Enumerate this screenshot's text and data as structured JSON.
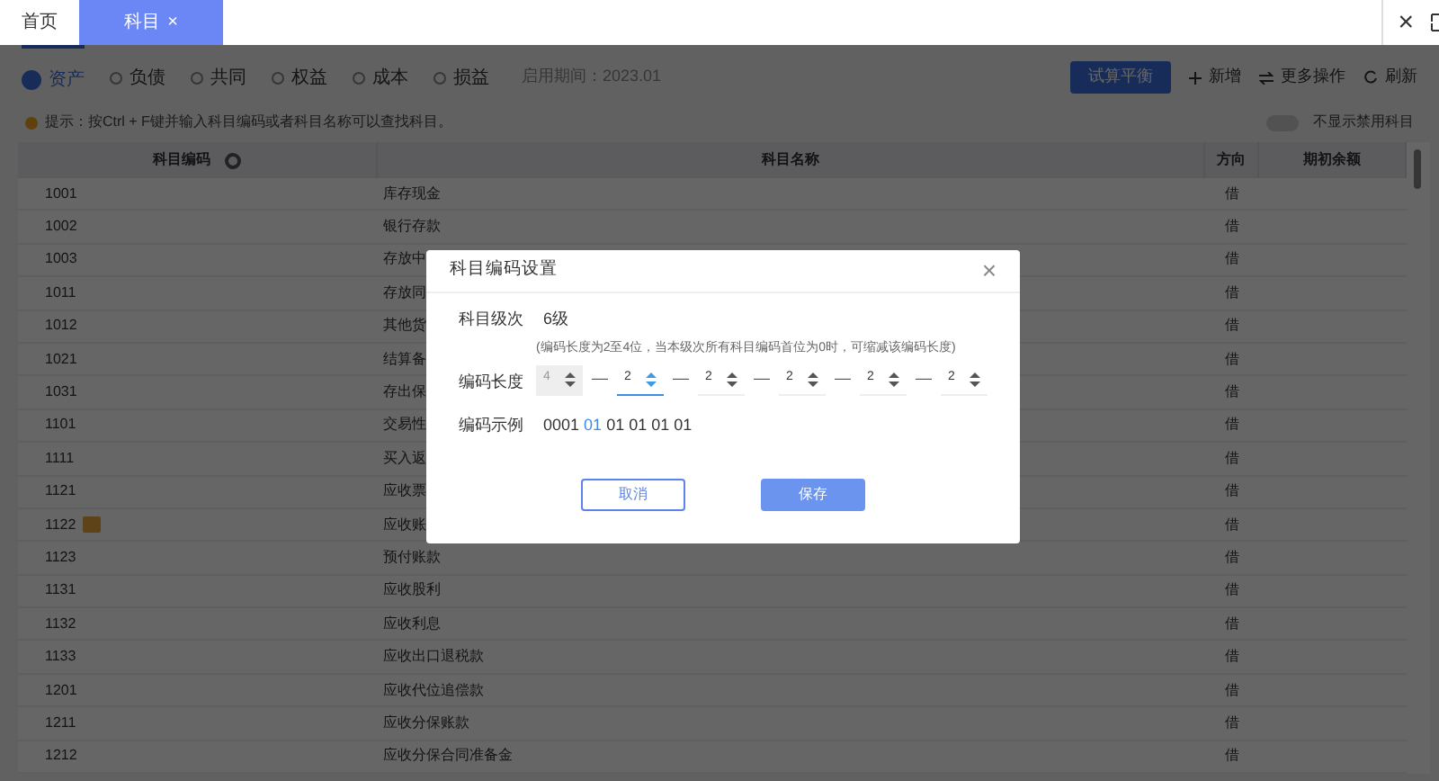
{
  "top_tabs": [
    {
      "label": "首页",
      "selected": false
    },
    {
      "label": "科目",
      "selected": true,
      "close": "×"
    }
  ],
  "window_controls": {
    "close": "×"
  },
  "categories": [
    {
      "label": "资产",
      "selected": true
    },
    {
      "label": "负债",
      "selected": false
    },
    {
      "label": "共同",
      "selected": false
    },
    {
      "label": "权益",
      "selected": false
    },
    {
      "label": "成本",
      "selected": false
    },
    {
      "label": "损益",
      "selected": false
    }
  ],
  "period": "启用期间：2023.01",
  "actions": {
    "primary": "试算平衡",
    "add": "新增",
    "more": "更多操作",
    "refresh": "刷新"
  },
  "hint": "提示：按Ctrl + F键并输入科目编码或者科目名称可以查找科目。",
  "hide_disabled": {
    "label": "不显示禁用科目",
    "on": false
  },
  "table": {
    "columns": [
      "科目编码",
      "科目名称",
      "方向",
      "期初余额"
    ],
    "rows": [
      {
        "code": "1001",
        "name": "库存现金",
        "direction": "借",
        "tag": false
      },
      {
        "code": "1002",
        "name": "银行存款",
        "direction": "借",
        "tag": false
      },
      {
        "code": "1003",
        "name": "存放中",
        "direction": "借",
        "tag": false
      },
      {
        "code": "1011",
        "name": "存放同",
        "direction": "借",
        "tag": false
      },
      {
        "code": "1012",
        "name": "其他货",
        "direction": "借",
        "tag": false
      },
      {
        "code": "1021",
        "name": "结算备",
        "direction": "借",
        "tag": false
      },
      {
        "code": "1031",
        "name": "存出保",
        "direction": "借",
        "tag": false
      },
      {
        "code": "1101",
        "name": "交易性",
        "direction": "借",
        "tag": false
      },
      {
        "code": "1111",
        "name": "买入返",
        "direction": "借",
        "tag": false
      },
      {
        "code": "1121",
        "name": "应收票",
        "direction": "借",
        "tag": false
      },
      {
        "code": "1122",
        "name": "应收账",
        "direction": "借",
        "tag": true
      },
      {
        "code": "1123",
        "name": "预付账款",
        "direction": "借",
        "tag": false
      },
      {
        "code": "1131",
        "name": "应收股利",
        "direction": "借",
        "tag": false
      },
      {
        "code": "1132",
        "name": "应收利息",
        "direction": "借",
        "tag": false
      },
      {
        "code": "1133",
        "name": "应收出口退税款",
        "direction": "借",
        "tag": false
      },
      {
        "code": "1201",
        "name": "应收代位追偿款",
        "direction": "借",
        "tag": false
      },
      {
        "code": "1211",
        "name": "应收分保账款",
        "direction": "借",
        "tag": false
      },
      {
        "code": "1212",
        "name": "应收分保合同准备金",
        "direction": "借",
        "tag": false
      }
    ]
  },
  "dialog": {
    "title": "科目编码设置",
    "close": "×",
    "level_label": "科目级次",
    "level_value": "6级",
    "length_label": "编码长度",
    "length_note": "(编码长度为2至4位，当本级次所有科目编码首位为0时，可缩减该编码长度)",
    "lengths": [
      {
        "value": "4",
        "disabled": true,
        "focused": false
      },
      {
        "value": "2",
        "disabled": false,
        "focused": true
      },
      {
        "value": "2",
        "disabled": false,
        "focused": false
      },
      {
        "value": "2",
        "disabled": false,
        "focused": false
      },
      {
        "value": "2",
        "disabled": false,
        "focused": false
      },
      {
        "value": "2",
        "disabled": false,
        "focused": false
      }
    ],
    "separator": "—",
    "example_label": "编码示例",
    "example": [
      {
        "text": "0001",
        "highlighted": false
      },
      {
        "text": "01",
        "highlighted": true
      },
      {
        "text": "01",
        "highlighted": false
      },
      {
        "text": "01",
        "highlighted": false
      },
      {
        "text": "01",
        "highlighted": false
      },
      {
        "text": "01",
        "highlighted": false
      }
    ],
    "cancel": "取消",
    "save": "保存"
  }
}
